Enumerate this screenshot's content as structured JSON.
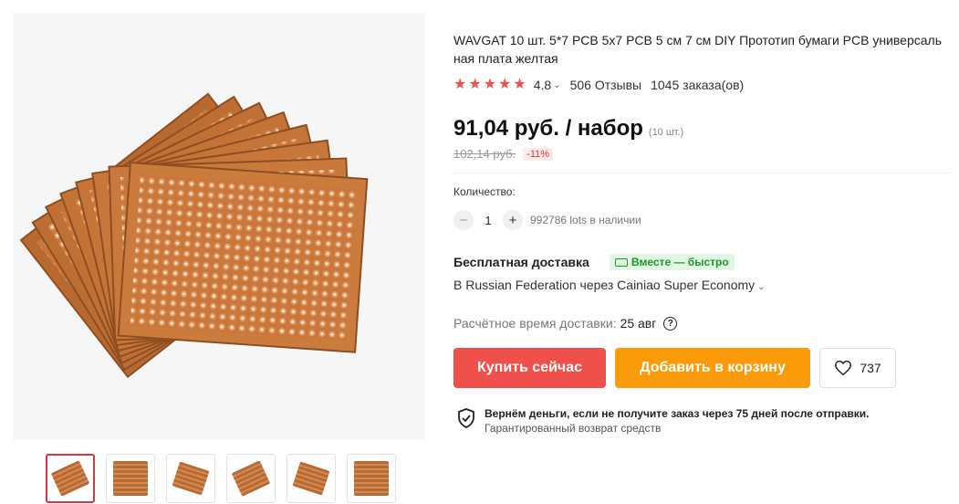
{
  "product": {
    "title": "WAVGAT 10 шт. 5*7 PCB 5x7 PCB 5 см 7 см DIY Прототип бумаги PCB универсаль ная плата желтая",
    "rating": "4.8",
    "reviews": "506 Отзывы",
    "orders": "1045 заказа(ов)",
    "price": "91,04 руб. / набор",
    "unit": "(10 шт.)",
    "old_price": "102,14 руб.",
    "discount": "-11%"
  },
  "quantity": {
    "label": "Количество:",
    "value": "1",
    "minus": "−",
    "plus": "+",
    "stock": "992786 lots в наличии"
  },
  "shipping": {
    "title": "Бесплатная доставка",
    "badge": "Вместе — быстро",
    "route": "В Russian Federation через Cainiao Super Economy",
    "eta_label": "Расчётное время доставки:",
    "eta_date": "25 авг",
    "help": "?"
  },
  "actions": {
    "buy": "Купить сейчас",
    "cart": "Добавить в корзину",
    "wishlist_count": "737"
  },
  "guarantee": {
    "title": "Вернём деньги, если не получите заказ через 75 дней после отправки.",
    "subtitle": "Гарантированный возврат средств"
  },
  "colors": {
    "accent_red": "#f0504a",
    "accent_orange": "#fb9b0a",
    "badge_green": "#1a9a2a"
  },
  "icons": [
    "star-icon",
    "chevron-down-icon",
    "truck-icon",
    "help-icon",
    "heart-icon",
    "shield-check-icon"
  ]
}
